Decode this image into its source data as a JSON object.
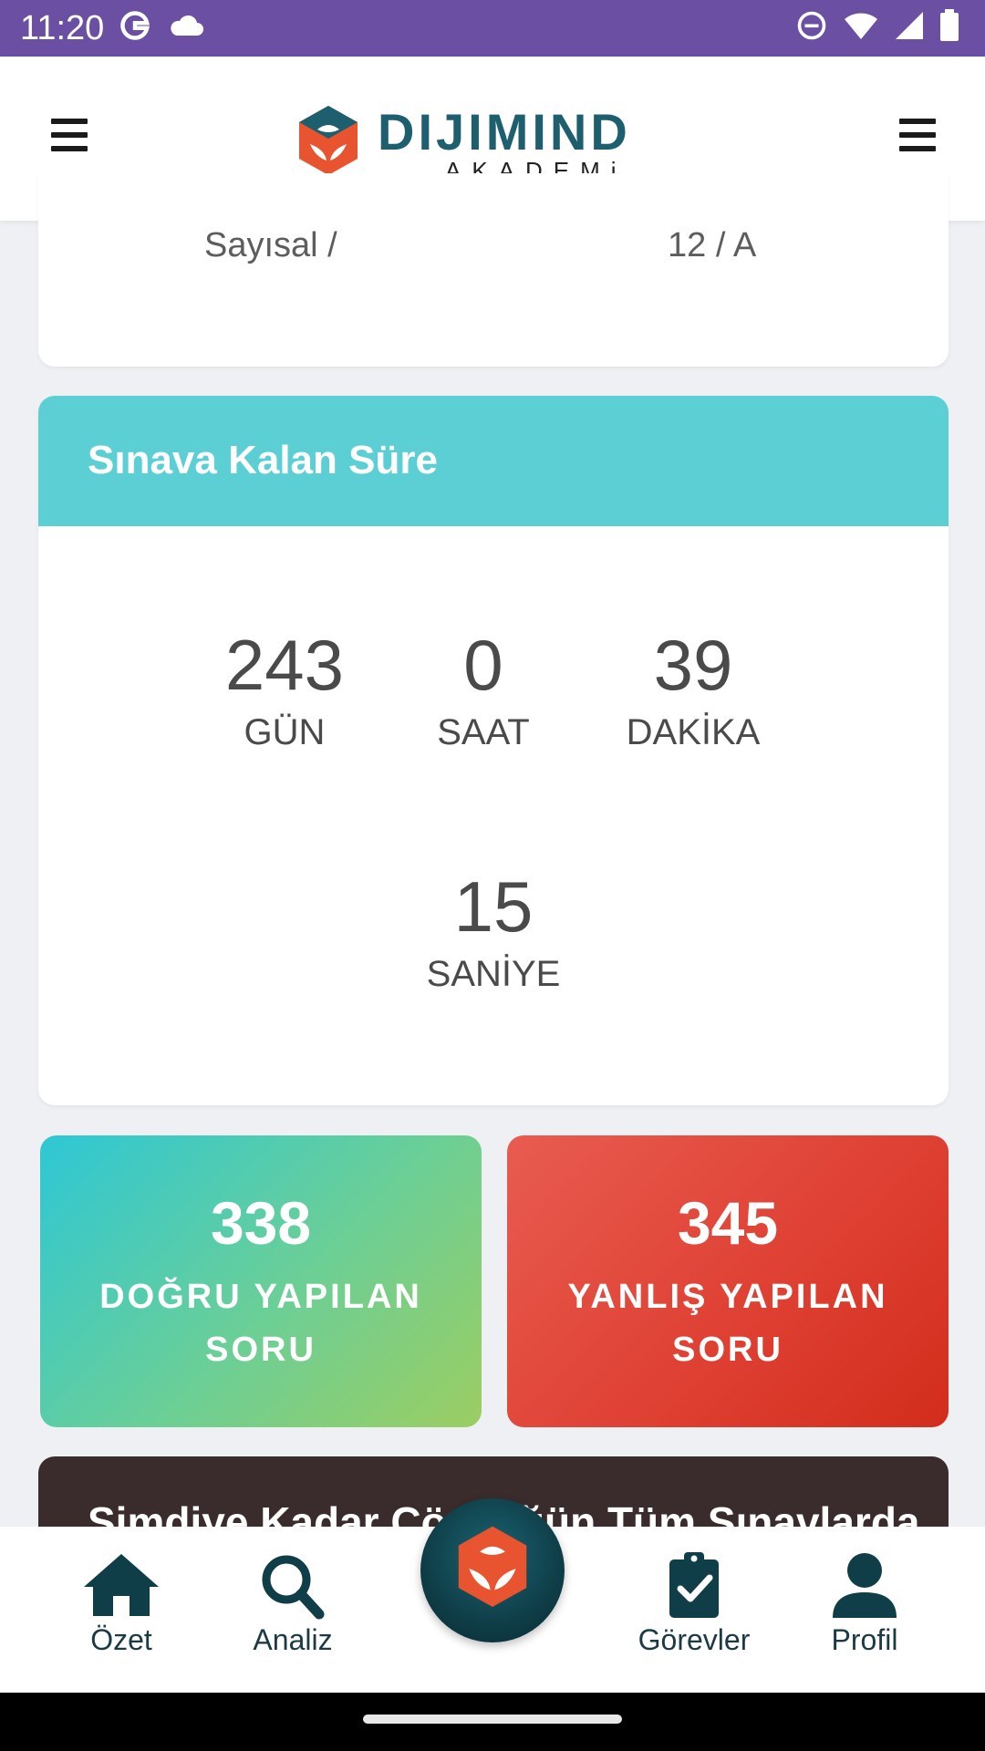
{
  "status_bar": {
    "time": "11:20",
    "icons_left": [
      "google-icon",
      "cloud-icon"
    ],
    "icons_right": [
      "do-not-disturb-icon",
      "wifi-icon",
      "signal-icon",
      "battery-icon"
    ]
  },
  "app_bar": {
    "brand_title": "DIJIMIND",
    "brand_subtitle": "AKADEMi",
    "brand_colors": {
      "teal": "#1d5f6f",
      "orange": "#e8542f"
    }
  },
  "profile_card": {
    "field": "Sayısal /",
    "class": "12 / A"
  },
  "countdown": {
    "title": "Sınava Kalan Süre",
    "header_color": "#5bcfd4",
    "units": [
      {
        "value": "243",
        "label": "GÜN"
      },
      {
        "value": "0",
        "label": "SAAT"
      },
      {
        "value": "39",
        "label": "DAKİKA"
      },
      {
        "value": "15",
        "label": "SANİYE"
      }
    ]
  },
  "stats": {
    "correct": {
      "value": "338",
      "label": "DOĞRU YAPILAN SORU"
    },
    "wrong": {
      "value": "345",
      "label": "YANLIŞ YAPILAN SORU"
    }
  },
  "summary_card": {
    "title": "Şimdiye Kadar Çözdüğün Tüm Sınavlarda"
  },
  "bottom_nav": {
    "items": [
      {
        "label": "Özet",
        "icon": "home-icon"
      },
      {
        "label": "Analiz",
        "icon": "search-icon"
      },
      {
        "label": "Görevler",
        "icon": "clipboard-check-icon"
      },
      {
        "label": "Profil",
        "icon": "user-icon"
      }
    ],
    "center_button_icon": "dijimind-logo-icon"
  }
}
